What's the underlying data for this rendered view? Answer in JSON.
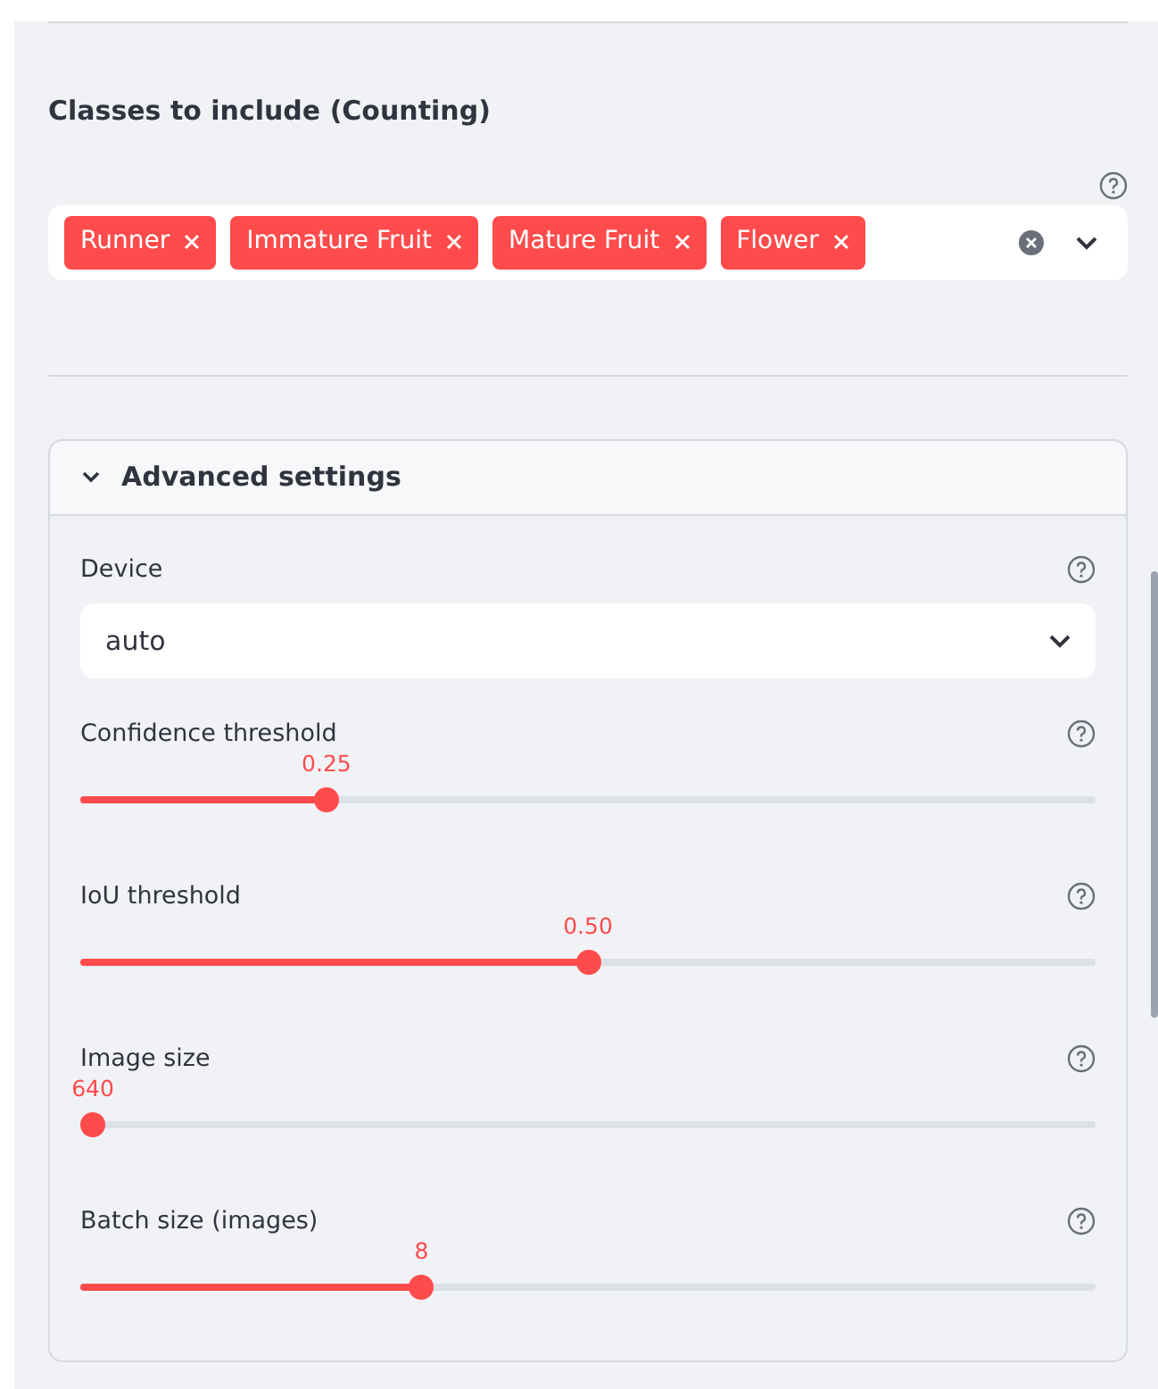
{
  "classes": {
    "title": "Classes to include (Counting)",
    "tags": [
      {
        "label": "Runner"
      },
      {
        "label": "Immature Fruit"
      },
      {
        "label": "Mature Fruit"
      },
      {
        "label": "Flower"
      }
    ]
  },
  "advanced": {
    "title": "Advanced settings",
    "expanded": true,
    "device": {
      "label": "Device",
      "value": "auto"
    },
    "sliders": [
      {
        "label": "Confidence threshold",
        "reading": "0.25",
        "level": 0.236
      },
      {
        "label": "IoU threshold",
        "reading": "0.50",
        "level": 0.5
      },
      {
        "label": "Image size",
        "reading": "640",
        "level": 0
      },
      {
        "label": "Batch size (images)",
        "reading": "8",
        "level": 0.332
      }
    ]
  }
}
